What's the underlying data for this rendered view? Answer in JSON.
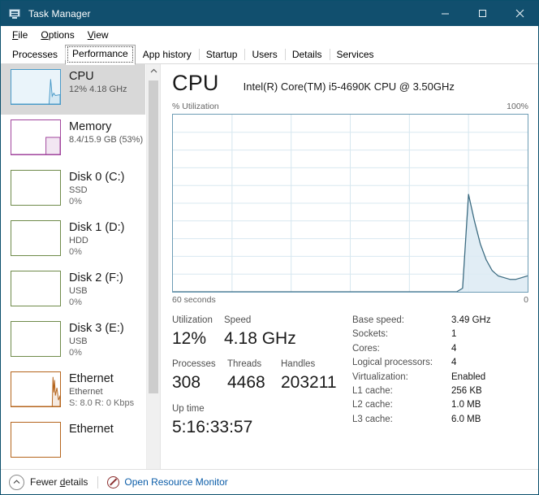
{
  "window": {
    "title": "Task Manager",
    "icon": "task-manager-icon",
    "controls": {
      "minimize": "—",
      "maximize": "□",
      "close": "✕"
    }
  },
  "menu": {
    "items": [
      "File",
      "Options",
      "View"
    ]
  },
  "tabs": {
    "items": [
      "Processes",
      "Performance",
      "App history",
      "Startup",
      "Users",
      "Details",
      "Services"
    ],
    "active": "Performance"
  },
  "sidebar": {
    "items": [
      {
        "title": "CPU",
        "sub1": "12%  4.18 GHz",
        "sub2": "",
        "color": "#4a9ac8",
        "fill": "#eaf4fa",
        "selected": true
      },
      {
        "title": "Memory",
        "sub1": "8.4/15.9 GB (53%)",
        "sub2": "",
        "color": "#a1459d",
        "fill": "#ffffff",
        "selected": false
      },
      {
        "title": "Disk 0 (C:)",
        "sub1": "SSD",
        "sub2": "0%",
        "color": "#6f8b4a",
        "fill": "#ffffff",
        "selected": false
      },
      {
        "title": "Disk 1 (D:)",
        "sub1": "HDD",
        "sub2": "0%",
        "color": "#6f8b4a",
        "fill": "#ffffff",
        "selected": false
      },
      {
        "title": "Disk 2 (F:)",
        "sub1": "USB",
        "sub2": "0%",
        "color": "#6f8b4a",
        "fill": "#ffffff",
        "selected": false
      },
      {
        "title": "Disk 3 (E:)",
        "sub1": "USB",
        "sub2": "0%",
        "color": "#6f8b4a",
        "fill": "#ffffff",
        "selected": false
      },
      {
        "title": "Ethernet",
        "sub1": "Ethernet",
        "sub2": "S: 8.0 R: 0 Kbps",
        "color": "#b5651d",
        "fill": "#ffffff",
        "selected": false
      },
      {
        "title": "Ethernet",
        "sub1": "",
        "sub2": "",
        "color": "#b5651d",
        "fill": "#ffffff",
        "selected": false
      }
    ],
    "scroll_up_icon": "chevron-up-icon",
    "scroll_down_icon": "chevron-down-icon"
  },
  "main": {
    "heading": "CPU",
    "model": "Intel(R) Core(TM) i5-4690K CPU @ 3.50GHz",
    "graph_axis_left": "% Utilization",
    "graph_axis_right": "100%",
    "time_left": "60 seconds",
    "time_right": "0",
    "stats_left": [
      {
        "label": "Utilization",
        "value": "12%"
      },
      {
        "label": "Speed",
        "value": "4.18 GHz"
      },
      {
        "label": "Processes",
        "value": "308"
      },
      {
        "label": "Threads",
        "value": "4468"
      },
      {
        "label": "Handles",
        "value": "203211"
      },
      {
        "label": "Up time",
        "value": "5:16:33:57"
      }
    ],
    "stats_right": [
      {
        "name": "Base speed:",
        "value": "3.49 GHz"
      },
      {
        "name": "Sockets:",
        "value": "1"
      },
      {
        "name": "Cores:",
        "value": "4"
      },
      {
        "name": "Logical processors:",
        "value": "4"
      },
      {
        "name": "Virtualization:",
        "value": "Enabled"
      },
      {
        "name": "L1 cache:",
        "value": "256 KB"
      },
      {
        "name": "L2 cache:",
        "value": "1.0 MB"
      },
      {
        "name": "L3 cache:",
        "value": "6.0 MB"
      }
    ]
  },
  "statusbar": {
    "fewer_details": "Fewer details",
    "fewer_details_icon": "chevron-up-circle-icon",
    "resource_monitor": "Open Resource Monitor",
    "resource_monitor_icon": "resource-monitor-icon"
  },
  "chart_data": {
    "type": "area",
    "title": "CPU % Utilization over 60 seconds",
    "xlabel": "60 seconds",
    "ylabel": "% Utilization",
    "xlim": [
      0,
      60
    ],
    "ylim": [
      0,
      100
    ],
    "grid": true,
    "grid_columns": 6,
    "grid_rows": 10,
    "line_color": "#3a6a80",
    "fill_color": "#dceaf3",
    "x": [
      0,
      46,
      47,
      48,
      49,
      50,
      51,
      52,
      53,
      54,
      55,
      56,
      57,
      58,
      59,
      60
    ],
    "values": [
      0,
      0,
      0,
      0,
      2,
      55,
      40,
      27,
      18,
      12,
      9,
      8,
      7,
      7,
      8,
      9
    ]
  }
}
